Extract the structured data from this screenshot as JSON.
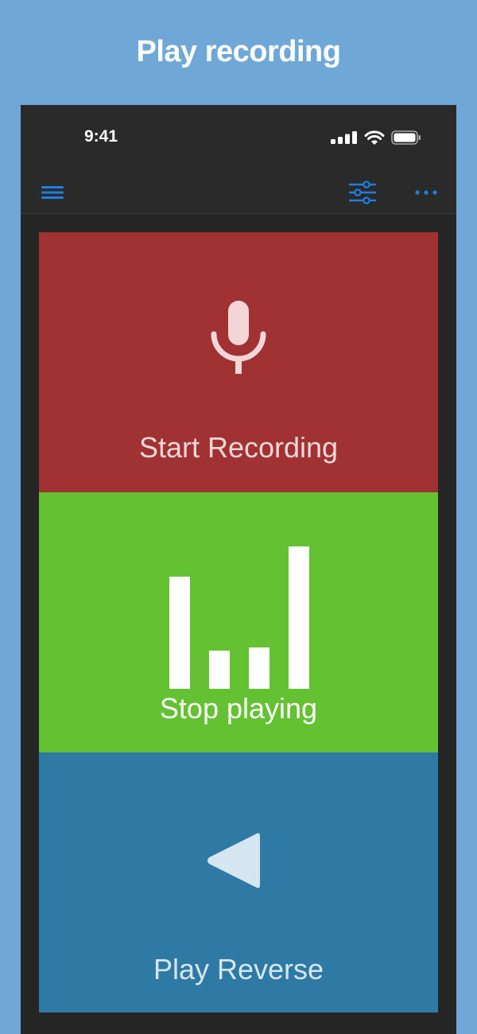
{
  "headline": "Play recording",
  "status_bar": {
    "time": "9:41"
  },
  "navbar": {
    "menu_icon": "hamburger-icon",
    "filter_icon": "sliders-icon",
    "more_icon": "ellipsis-icon"
  },
  "tiles": {
    "record": {
      "label": "Start Recording",
      "icon": "microphone-icon",
      "color": "#a03234"
    },
    "playing": {
      "label": "Stop playing",
      "icon": "audio-level-bars-icon",
      "color": "#63c132",
      "levels": [
        0.79,
        0.27,
        0.29,
        1.0
      ]
    },
    "reverse": {
      "label": "Play Reverse",
      "icon": "reverse-play-icon",
      "color": "#2f7aa4"
    }
  },
  "colors": {
    "background": "#6fa8d6",
    "accent": "#1e7fe0"
  }
}
